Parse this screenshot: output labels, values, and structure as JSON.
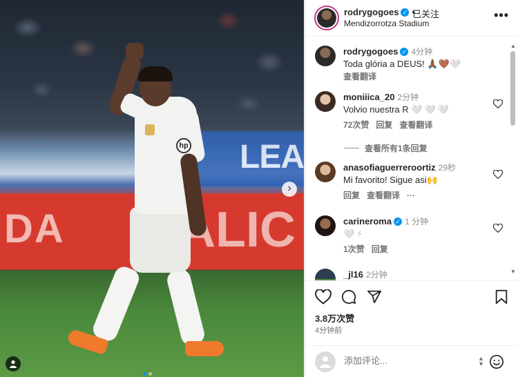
{
  "post": {
    "username": "rodrygogoes",
    "follow_status": "已关注",
    "location": "Mendizorrotza Stadium",
    "more_label": "•••"
  },
  "media": {
    "banner_left_text": "DA",
    "banner_right_text": "ALIC",
    "banner_blue_text": "LEA",
    "sponsor_text": "hp",
    "next_label": "›"
  },
  "comments": [
    {
      "username": "rodrygogoes",
      "time": "4分钟",
      "text": "Toda glória a DEUS! 🙏🏾🤎🤍",
      "translate": "查看翻译"
    },
    {
      "username": "moniiica_20",
      "time": "2分钟",
      "text": "Volvio nuestra R",
      "emoji": "🤍🤍🤍",
      "likes": "72次赞",
      "reply": "回复",
      "translate": "查看翻译",
      "view_replies": "查看所有1条回复"
    },
    {
      "username": "anasofiaguerreroortiz",
      "time": "29秒",
      "text": "Mi favorito! Sigue asi🙌",
      "reply": "回复",
      "translate": "查看翻译",
      "more": "···"
    },
    {
      "username": "carineroma",
      "time": "1 分钟",
      "text": "🤍⚡",
      "likes": "1次赞",
      "reply": "回复"
    },
    {
      "username": "_jl16",
      "time": "2分钟"
    }
  ],
  "actions": {
    "likes": "3.8万次赞",
    "posted_ago": "4分钟前"
  },
  "composer": {
    "placeholder": "添加评论..."
  },
  "colors": {
    "accent": "#0095f6",
    "text": "#262626",
    "muted": "#737373"
  }
}
